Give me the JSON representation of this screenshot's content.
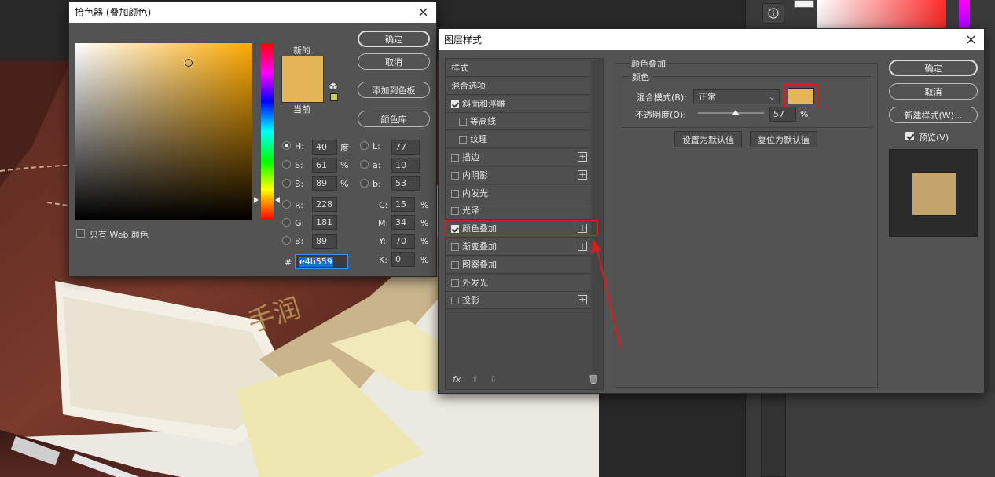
{
  "color_picker": {
    "title": "拾色器 (叠加颜色)",
    "new_label": "新的",
    "current_label": "当前",
    "new_color": "#e4b559",
    "current_color": "#e4b559",
    "buttons": {
      "ok": "确定",
      "cancel": "取消",
      "add_swatch": "添加到色板",
      "libraries": "颜色库"
    },
    "web_only_label": "只有 Web 颜色",
    "hsb": {
      "h_label": "H:",
      "h": "40",
      "h_unit": "度",
      "s_label": "S:",
      "s": "61",
      "s_unit": "%",
      "b_label": "B:",
      "b": "89",
      "b_unit": "%"
    },
    "rgb": {
      "r_label": "R:",
      "r": "228",
      "g_label": "G:",
      "g": "181",
      "b_label": "B:",
      "b": "89"
    },
    "lab": {
      "l_label": "L:",
      "l": "77",
      "a_label": "a:",
      "a": "10",
      "b_label": "b:",
      "b": "53"
    },
    "cmyk": {
      "c_label": "C:",
      "c": "15",
      "m_label": "M:",
      "m": "34",
      "y_label": "Y:",
      "y": "70",
      "k_label": "K:",
      "k": "0",
      "unit": "%"
    },
    "hex_label": "#",
    "hex": "e4b559"
  },
  "layer_style": {
    "title": "图层样式",
    "styles": [
      {
        "label": "样式",
        "checkbox": false,
        "plus": false,
        "indent": false,
        "checked": false
      },
      {
        "label": "混合选项",
        "checkbox": false,
        "plus": false,
        "indent": false,
        "checked": false
      },
      {
        "label": "斜面和浮雕",
        "checkbox": true,
        "plus": false,
        "indent": false,
        "checked": true
      },
      {
        "label": "等高线",
        "checkbox": true,
        "plus": false,
        "indent": true,
        "checked": false
      },
      {
        "label": "纹理",
        "checkbox": true,
        "plus": false,
        "indent": true,
        "checked": false
      },
      {
        "label": "描边",
        "checkbox": true,
        "plus": true,
        "indent": false,
        "checked": false
      },
      {
        "label": "内阴影",
        "checkbox": true,
        "plus": true,
        "indent": false,
        "checked": false
      },
      {
        "label": "内发光",
        "checkbox": true,
        "plus": false,
        "indent": false,
        "checked": false
      },
      {
        "label": "光泽",
        "checkbox": true,
        "plus": false,
        "indent": false,
        "checked": false
      },
      {
        "label": "颜色叠加",
        "checkbox": true,
        "plus": true,
        "indent": false,
        "checked": true
      },
      {
        "label": "渐变叠加",
        "checkbox": true,
        "plus": true,
        "indent": false,
        "checked": false
      },
      {
        "label": "图案叠加",
        "checkbox": true,
        "plus": false,
        "indent": false,
        "checked": false
      },
      {
        "label": "外发光",
        "checkbox": true,
        "plus": false,
        "indent": false,
        "checked": false
      },
      {
        "label": "投影",
        "checkbox": true,
        "plus": true,
        "indent": false,
        "checked": false
      }
    ],
    "footer": {
      "fx": "fx",
      "up": "⇧",
      "down": "⇩",
      "trash": "🗑"
    },
    "section_title": "颜色叠加",
    "group_title": "颜色",
    "blend_label": "混合模式(B):",
    "blend_value": "正常",
    "overlay_color": "#e4b559",
    "opacity_label": "不透明度(O):",
    "opacity_value": "57",
    "opacity_unit": "%",
    "opacity_fraction": 0.57,
    "set_default": "设置为默认值",
    "reset_default": "复位为默认值",
    "buttons": {
      "ok": "确定",
      "cancel": "取消",
      "new_style": "新建样式(W)..."
    },
    "preview_label": "预览(V)",
    "preview_checked": true,
    "preview_color": "#c3a46d"
  },
  "highlight_color": "#e0191f"
}
